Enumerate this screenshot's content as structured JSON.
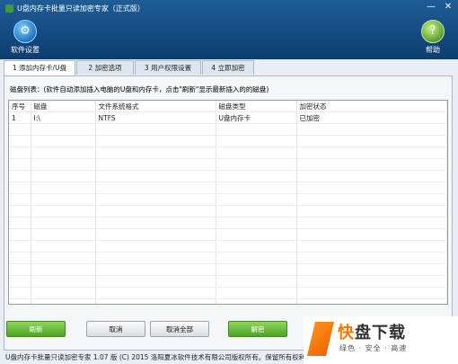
{
  "window": {
    "title": "U盘内存卡批量只读加密专家（正式版）",
    "min_glyph": "—",
    "close_glyph": "✕"
  },
  "toolbar": {
    "settings_label": "软件设置",
    "help_label": "帮助",
    "settings_icon": "gear-icon",
    "help_icon": "help-question-icon"
  },
  "tabs": [
    {
      "label": "1 添加内存卡/U盘",
      "active": true
    },
    {
      "label": "2 加密选项",
      "active": false
    },
    {
      "label": "3 用户权限设置",
      "active": false
    },
    {
      "label": "4 立即加密",
      "active": false
    }
  ],
  "disk_list": {
    "caption": "磁盘列表：(软件自动添加插入电脑的U盘和内存卡，点击\"刷新\"显示最新插入的的磁盘)",
    "columns": [
      "序号",
      "磁盘",
      "文件系统格式",
      "磁盘类型",
      "加密状态"
    ],
    "rows": [
      [
        "1",
        "I:\\",
        "NTFS",
        "U盘内存卡",
        "已加密"
      ]
    ]
  },
  "buttons": {
    "refresh": "刷新",
    "cancel": "取消",
    "cancel_all": "取消全部",
    "decrypt": "解密"
  },
  "status": {
    "text": "U盘内存卡批量只读加密专家 1.07 版 (C) 2015 洛阳夏冰软件技术有限公司版权所有。保留所有权利。"
  },
  "watermark": {
    "brand_accent": "快",
    "brand_rest": "盘下载",
    "slogan": "绿色 · 安全 · 高速"
  },
  "colors": {
    "titlebar": "#1f5d96",
    "green_button": "#4ea524",
    "watermark_orange": "#f07a00"
  }
}
